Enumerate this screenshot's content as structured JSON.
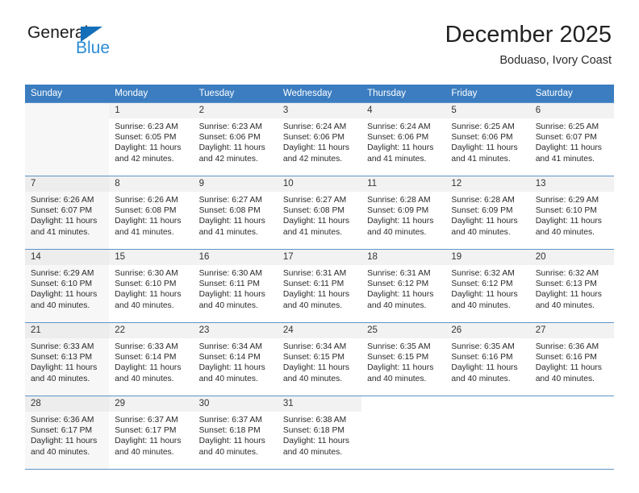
{
  "brand": {
    "name_part1": "General",
    "name_part2": "Blue",
    "color_blue": "#2b8bd4",
    "triangle_color": "#156fb8"
  },
  "header": {
    "title": "December 2025",
    "subtitle": "Boduaso, Ivory Coast"
  },
  "calendar": {
    "header_bg": "#3b7dc0",
    "weekdays": [
      "Sunday",
      "Monday",
      "Tuesday",
      "Wednesday",
      "Thursday",
      "Friday",
      "Saturday"
    ],
    "weeks": [
      [
        {
          "day": "",
          "sunrise": "",
          "sunset": "",
          "daylight1": "",
          "daylight2": ""
        },
        {
          "day": "1",
          "sunrise": "Sunrise: 6:23 AM",
          "sunset": "Sunset: 6:05 PM",
          "daylight1": "Daylight: 11 hours",
          "daylight2": "and 42 minutes."
        },
        {
          "day": "2",
          "sunrise": "Sunrise: 6:23 AM",
          "sunset": "Sunset: 6:06 PM",
          "daylight1": "Daylight: 11 hours",
          "daylight2": "and 42 minutes."
        },
        {
          "day": "3",
          "sunrise": "Sunrise: 6:24 AM",
          "sunset": "Sunset: 6:06 PM",
          "daylight1": "Daylight: 11 hours",
          "daylight2": "and 42 minutes."
        },
        {
          "day": "4",
          "sunrise": "Sunrise: 6:24 AM",
          "sunset": "Sunset: 6:06 PM",
          "daylight1": "Daylight: 11 hours",
          "daylight2": "and 41 minutes."
        },
        {
          "day": "5",
          "sunrise": "Sunrise: 6:25 AM",
          "sunset": "Sunset: 6:06 PM",
          "daylight1": "Daylight: 11 hours",
          "daylight2": "and 41 minutes."
        },
        {
          "day": "6",
          "sunrise": "Sunrise: 6:25 AM",
          "sunset": "Sunset: 6:07 PM",
          "daylight1": "Daylight: 11 hours",
          "daylight2": "and 41 minutes."
        }
      ],
      [
        {
          "day": "7",
          "sunrise": "Sunrise: 6:26 AM",
          "sunset": "Sunset: 6:07 PM",
          "daylight1": "Daylight: 11 hours",
          "daylight2": "and 41 minutes."
        },
        {
          "day": "8",
          "sunrise": "Sunrise: 6:26 AM",
          "sunset": "Sunset: 6:08 PM",
          "daylight1": "Daylight: 11 hours",
          "daylight2": "and 41 minutes."
        },
        {
          "day": "9",
          "sunrise": "Sunrise: 6:27 AM",
          "sunset": "Sunset: 6:08 PM",
          "daylight1": "Daylight: 11 hours",
          "daylight2": "and 41 minutes."
        },
        {
          "day": "10",
          "sunrise": "Sunrise: 6:27 AM",
          "sunset": "Sunset: 6:08 PM",
          "daylight1": "Daylight: 11 hours",
          "daylight2": "and 41 minutes."
        },
        {
          "day": "11",
          "sunrise": "Sunrise: 6:28 AM",
          "sunset": "Sunset: 6:09 PM",
          "daylight1": "Daylight: 11 hours",
          "daylight2": "and 40 minutes."
        },
        {
          "day": "12",
          "sunrise": "Sunrise: 6:28 AM",
          "sunset": "Sunset: 6:09 PM",
          "daylight1": "Daylight: 11 hours",
          "daylight2": "and 40 minutes."
        },
        {
          "day": "13",
          "sunrise": "Sunrise: 6:29 AM",
          "sunset": "Sunset: 6:10 PM",
          "daylight1": "Daylight: 11 hours",
          "daylight2": "and 40 minutes."
        }
      ],
      [
        {
          "day": "14",
          "sunrise": "Sunrise: 6:29 AM",
          "sunset": "Sunset: 6:10 PM",
          "daylight1": "Daylight: 11 hours",
          "daylight2": "and 40 minutes."
        },
        {
          "day": "15",
          "sunrise": "Sunrise: 6:30 AM",
          "sunset": "Sunset: 6:10 PM",
          "daylight1": "Daylight: 11 hours",
          "daylight2": "and 40 minutes."
        },
        {
          "day": "16",
          "sunrise": "Sunrise: 6:30 AM",
          "sunset": "Sunset: 6:11 PM",
          "daylight1": "Daylight: 11 hours",
          "daylight2": "and 40 minutes."
        },
        {
          "day": "17",
          "sunrise": "Sunrise: 6:31 AM",
          "sunset": "Sunset: 6:11 PM",
          "daylight1": "Daylight: 11 hours",
          "daylight2": "and 40 minutes."
        },
        {
          "day": "18",
          "sunrise": "Sunrise: 6:31 AM",
          "sunset": "Sunset: 6:12 PM",
          "daylight1": "Daylight: 11 hours",
          "daylight2": "and 40 minutes."
        },
        {
          "day": "19",
          "sunrise": "Sunrise: 6:32 AM",
          "sunset": "Sunset: 6:12 PM",
          "daylight1": "Daylight: 11 hours",
          "daylight2": "and 40 minutes."
        },
        {
          "day": "20",
          "sunrise": "Sunrise: 6:32 AM",
          "sunset": "Sunset: 6:13 PM",
          "daylight1": "Daylight: 11 hours",
          "daylight2": "and 40 minutes."
        }
      ],
      [
        {
          "day": "21",
          "sunrise": "Sunrise: 6:33 AM",
          "sunset": "Sunset: 6:13 PM",
          "daylight1": "Daylight: 11 hours",
          "daylight2": "and 40 minutes."
        },
        {
          "day": "22",
          "sunrise": "Sunrise: 6:33 AM",
          "sunset": "Sunset: 6:14 PM",
          "daylight1": "Daylight: 11 hours",
          "daylight2": "and 40 minutes."
        },
        {
          "day": "23",
          "sunrise": "Sunrise: 6:34 AM",
          "sunset": "Sunset: 6:14 PM",
          "daylight1": "Daylight: 11 hours",
          "daylight2": "and 40 minutes."
        },
        {
          "day": "24",
          "sunrise": "Sunrise: 6:34 AM",
          "sunset": "Sunset: 6:15 PM",
          "daylight1": "Daylight: 11 hours",
          "daylight2": "and 40 minutes."
        },
        {
          "day": "25",
          "sunrise": "Sunrise: 6:35 AM",
          "sunset": "Sunset: 6:15 PM",
          "daylight1": "Daylight: 11 hours",
          "daylight2": "and 40 minutes."
        },
        {
          "day": "26",
          "sunrise": "Sunrise: 6:35 AM",
          "sunset": "Sunset: 6:16 PM",
          "daylight1": "Daylight: 11 hours",
          "daylight2": "and 40 minutes."
        },
        {
          "day": "27",
          "sunrise": "Sunrise: 6:36 AM",
          "sunset": "Sunset: 6:16 PM",
          "daylight1": "Daylight: 11 hours",
          "daylight2": "and 40 minutes."
        }
      ],
      [
        {
          "day": "28",
          "sunrise": "Sunrise: 6:36 AM",
          "sunset": "Sunset: 6:17 PM",
          "daylight1": "Daylight: 11 hours",
          "daylight2": "and 40 minutes."
        },
        {
          "day": "29",
          "sunrise": "Sunrise: 6:37 AM",
          "sunset": "Sunset: 6:17 PM",
          "daylight1": "Daylight: 11 hours",
          "daylight2": "and 40 minutes."
        },
        {
          "day": "30",
          "sunrise": "Sunrise: 6:37 AM",
          "sunset": "Sunset: 6:18 PM",
          "daylight1": "Daylight: 11 hours",
          "daylight2": "and 40 minutes."
        },
        {
          "day": "31",
          "sunrise": "Sunrise: 6:38 AM",
          "sunset": "Sunset: 6:18 PM",
          "daylight1": "Daylight: 11 hours",
          "daylight2": "and 40 minutes."
        },
        {
          "day": "",
          "sunrise": "",
          "sunset": "",
          "daylight1": "",
          "daylight2": ""
        },
        {
          "day": "",
          "sunrise": "",
          "sunset": "",
          "daylight1": "",
          "daylight2": ""
        },
        {
          "day": "",
          "sunrise": "",
          "sunset": "",
          "daylight1": "",
          "daylight2": ""
        }
      ]
    ]
  }
}
